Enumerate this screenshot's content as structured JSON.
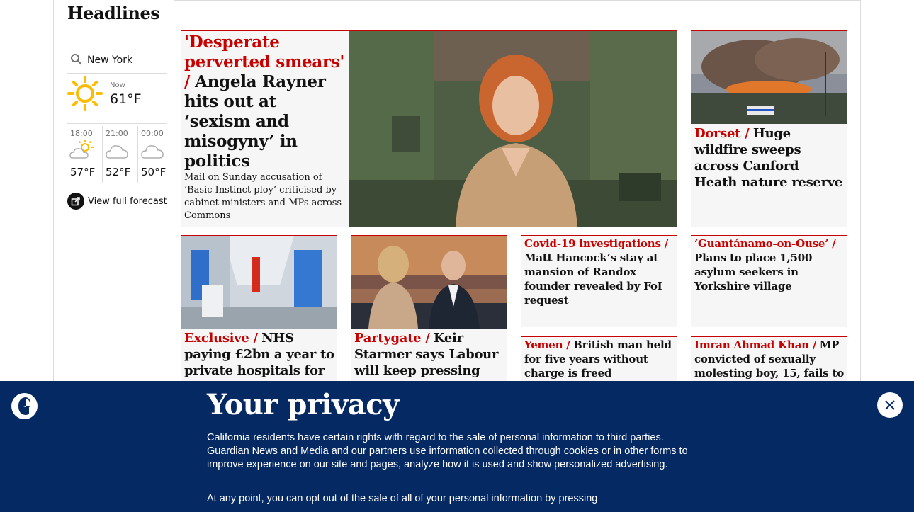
{
  "section": {
    "title": "Headlines"
  },
  "weather": {
    "location": "New York",
    "now_label": "Now",
    "now_temp": "61°F",
    "forecast": [
      {
        "time": "18:00",
        "temp": "57°F",
        "icon": "partly-cloudy-sun-icon"
      },
      {
        "time": "21:00",
        "temp": "52°F",
        "icon": "cloud-icon"
      },
      {
        "time": "00:00",
        "temp": "50°F",
        "icon": "cloud-icon"
      }
    ],
    "full_forecast_label": "View full forecast"
  },
  "stories": {
    "main": {
      "kicker": "'Desperate perverted smears' /",
      "headline": "Angela Rayner hits out at ‘sexism and misogyny’ in politics",
      "standfirst": "Mail on Sunday accusation of ‘Basic Instinct ploy’ criticised by cabinet ministers and MPs across Commons"
    },
    "dorset": {
      "kicker": "Dorset /",
      "headline": "Huge wildfire sweeps across Canford Heath nature reserve"
    },
    "exclusive": {
      "kicker": "Exclusive /",
      "headline": "NHS paying £2bn a year to private hospitals for"
    },
    "partygate": {
      "kicker": "Partygate /",
      "headline": "Keir Starmer says Labour will keep pressing"
    },
    "covid": {
      "kicker": "Covid-19 investigations /",
      "headline": "Matt Hancock’s stay at mansion of Randox founder revealed by FoI request"
    },
    "guantanamo": {
      "kicker": "‘Guantánamo-on-Ouse’ /",
      "headline": "Plans to place 1,500 asylum seekers in Yorkshire village"
    },
    "yemen": {
      "kicker": "Yemen /",
      "headline": "British man held for five years without charge is freed"
    },
    "imran": {
      "kicker": "Imran Ahmad Khan /",
      "headline": "MP convicted of sexually molesting boy, 15, fails to"
    }
  },
  "privacy": {
    "title": "Your privacy",
    "body": "California residents have certain rights with regard to the sale of personal information to third parties. Guardian News and Media and our partners use information collected through cookies or in other forms to improve experience on our site and pages, analyze how it is used and show personalized advertising.",
    "body2": "At any point, you can opt out of the sale of all of your personal information by pressing"
  },
  "colors": {
    "brand_navy": "#052962",
    "news_red": "#c70000"
  }
}
